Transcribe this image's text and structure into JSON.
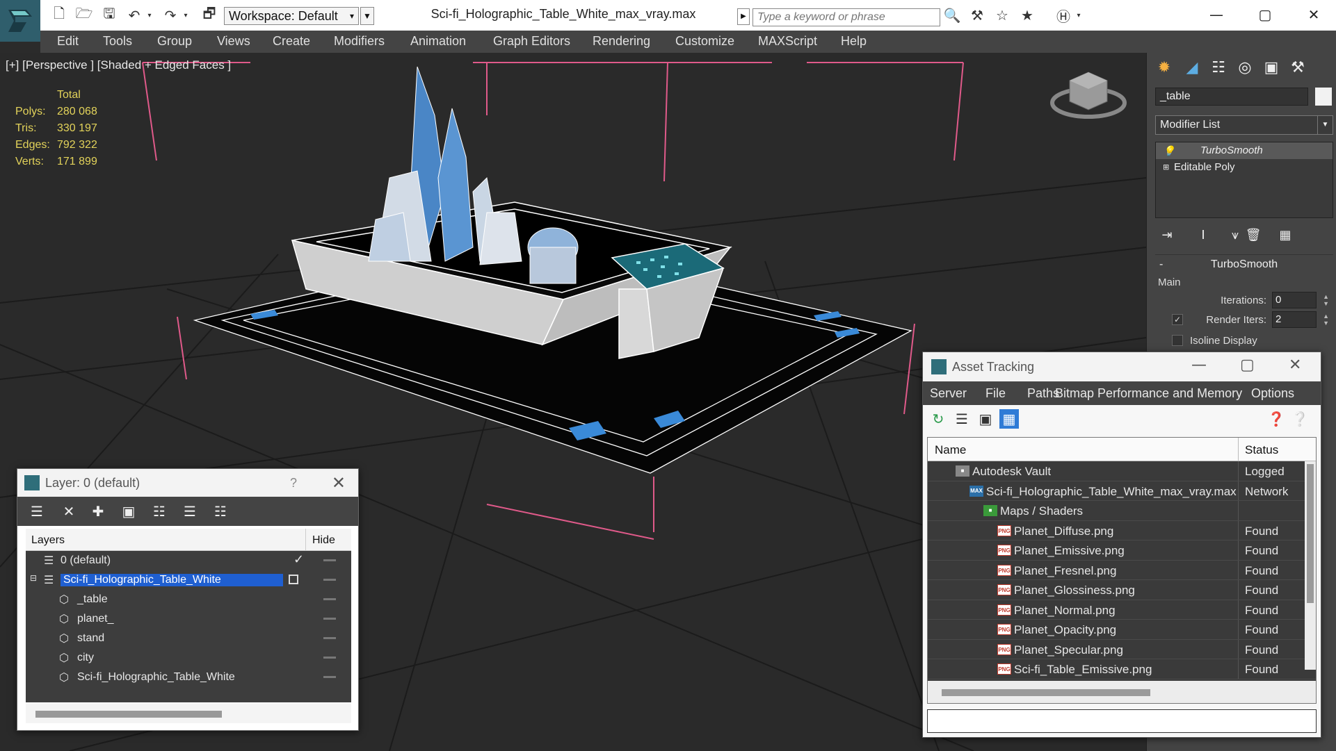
{
  "window": {
    "title": "Sci-fi_Holographic_Table_White_max_vray.max",
    "workspace": "Workspace: Default",
    "search_placeholder": "Type a keyword or phrase"
  },
  "menu": [
    "Edit",
    "Tools",
    "Group",
    "Views",
    "Create",
    "Modifiers",
    "Animation",
    "Graph Editors",
    "Rendering",
    "Customize",
    "MAXScript",
    "Help"
  ],
  "viewport": {
    "label": "[+] [Perspective ] [Shaded + Edged Faces ]",
    "stats": {
      "header": "Total",
      "rows": [
        {
          "k": "Polys:",
          "v": "280 068"
        },
        {
          "k": "Tris:",
          "v": "330 197"
        },
        {
          "k": "Edges:",
          "v": "792 322"
        },
        {
          "k": "Verts:",
          "v": "171 899"
        }
      ]
    },
    "colors": {
      "wire": "#ffffff",
      "blue": "#3a8ad8",
      "pink": "#e05a8a",
      "grid": "#1a1a1a"
    }
  },
  "command_panel": {
    "object_name": "_table",
    "modifier_list": "Modifier List",
    "stack": [
      "TurboSmooth",
      "Editable Poly"
    ],
    "turbosmooth": {
      "title": "TurboSmooth",
      "group": "Main",
      "iterations_label": "Iterations:",
      "iterations": "0",
      "render_iters_label": "Render Iters:",
      "render_iters": "2",
      "isoline_label": "Isoline Display"
    }
  },
  "layer_panel": {
    "title": "Layer: 0 (default)",
    "help": "?",
    "col_layers": "Layers",
    "col_hide": "Hide",
    "rows": [
      {
        "name": "0 (default)",
        "level": 0,
        "current": true
      },
      {
        "name": "Sci-fi_Holographic_Table_White",
        "level": 0,
        "selected": true
      },
      {
        "name": "_table",
        "level": 1
      },
      {
        "name": "planet_",
        "level": 1
      },
      {
        "name": "stand",
        "level": 1
      },
      {
        "name": "city",
        "level": 1
      },
      {
        "name": "Sci-fi_Holographic_Table_White",
        "level": 1
      }
    ]
  },
  "asset_panel": {
    "title": "Asset Tracking",
    "menu": [
      "Server",
      "File",
      "Paths",
      "Bitmap Performance and Memory",
      "Options"
    ],
    "col_name": "Name",
    "col_status": "Status",
    "rows": [
      {
        "name": "Autodesk Vault",
        "status": "Logged",
        "type": "vault",
        "level": 0
      },
      {
        "name": "Sci-fi_Holographic_Table_White_max_vray.max",
        "status": "Network",
        "type": "max",
        "level": 1
      },
      {
        "name": "Maps / Shaders",
        "status": "",
        "type": "folder",
        "level": 2
      },
      {
        "name": "Planet_Diffuse.png",
        "status": "Found",
        "type": "png",
        "level": 3
      },
      {
        "name": "Planet_Emissive.png",
        "status": "Found",
        "type": "png",
        "level": 3
      },
      {
        "name": "Planet_Fresnel.png",
        "status": "Found",
        "type": "png",
        "level": 3
      },
      {
        "name": "Planet_Glossiness.png",
        "status": "Found",
        "type": "png",
        "level": 3
      },
      {
        "name": "Planet_Normal.png",
        "status": "Found",
        "type": "png",
        "level": 3
      },
      {
        "name": "Planet_Opacity.png",
        "status": "Found",
        "type": "png",
        "level": 3
      },
      {
        "name": "Planet_Specular.png",
        "status": "Found",
        "type": "png",
        "level": 3
      },
      {
        "name": "Sci-fi_Table_Emissive.png",
        "status": "Found",
        "type": "png",
        "level": 3
      }
    ]
  }
}
